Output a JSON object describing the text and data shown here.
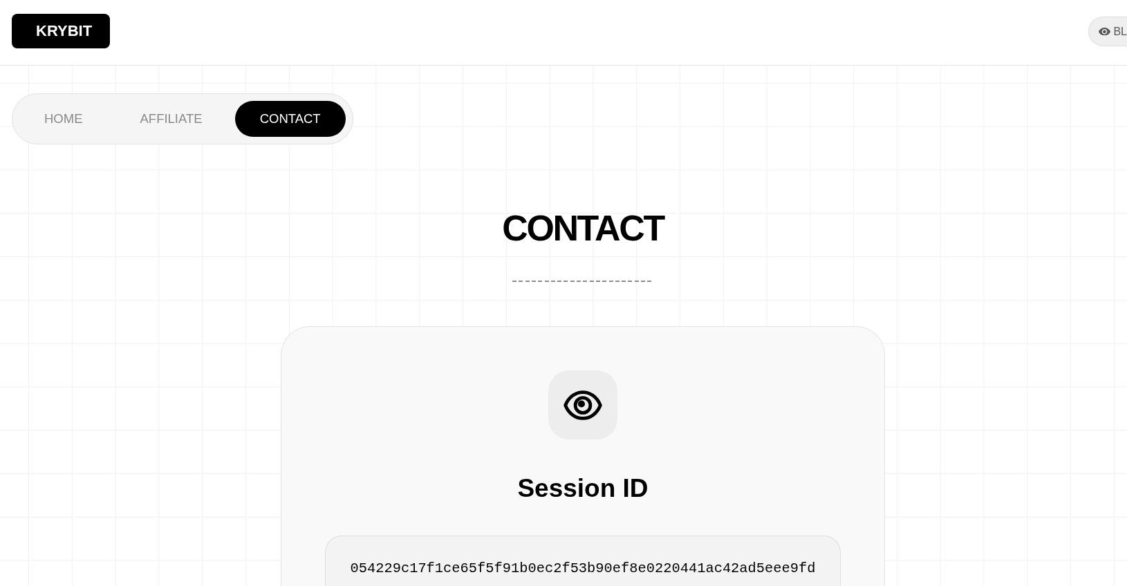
{
  "header": {
    "logo": "KRYBIT",
    "button": {
      "label": "BL"
    }
  },
  "nav": {
    "items": [
      {
        "label": "HOME",
        "selected": false
      },
      {
        "label": "AFFILIATE",
        "selected": false
      },
      {
        "label": "CONTACT",
        "selected": true
      }
    ]
  },
  "page": {
    "title": "CONTACT"
  },
  "card": {
    "title": "Session ID",
    "session_id": "054229c17f1ce65f5f91b0ec2f53b90ef8e0220441ac42ad5eee9fd"
  }
}
